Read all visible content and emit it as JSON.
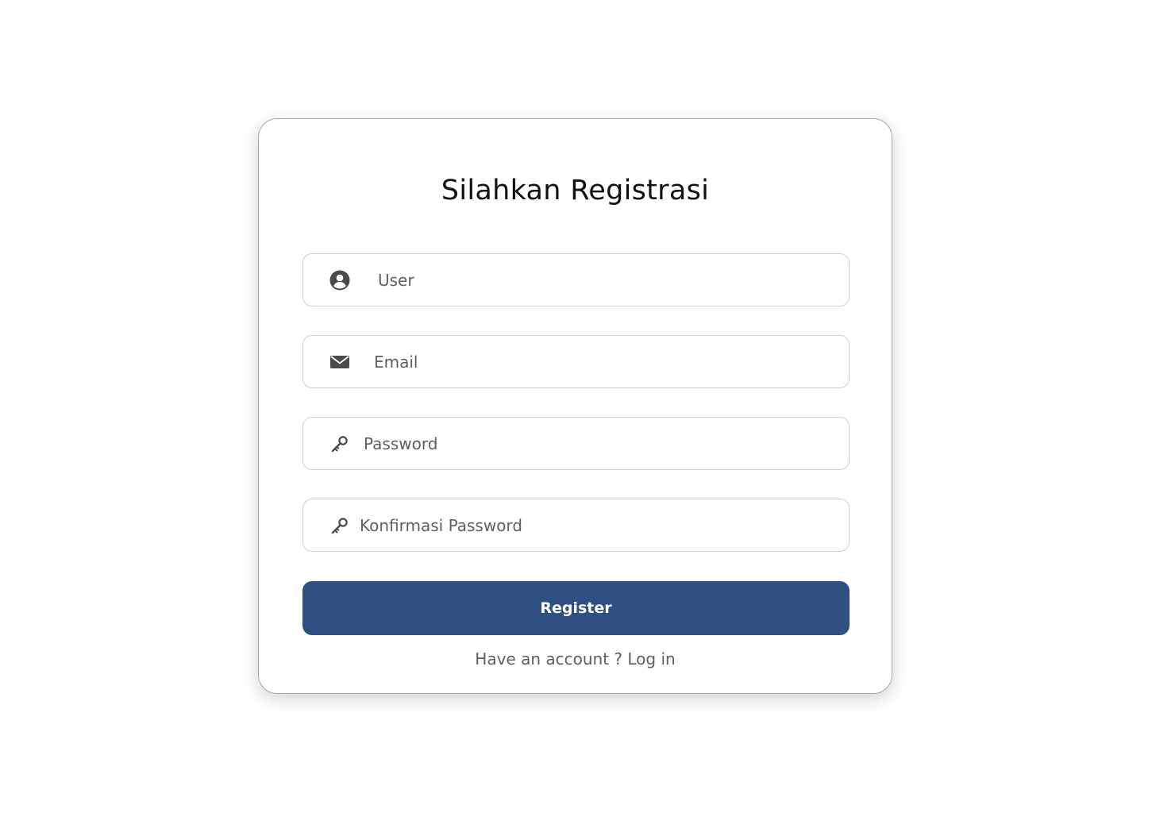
{
  "form": {
    "title": "Silahkan Registrasi",
    "fields": [
      {
        "icon": "user-circle-icon",
        "placeholder": "User",
        "value": ""
      },
      {
        "icon": "envelope-icon",
        "placeholder": "Email",
        "value": ""
      },
      {
        "icon": "key-icon",
        "placeholder": "Password",
        "value": ""
      },
      {
        "icon": "key-icon",
        "placeholder": "Konfirmasi Password",
        "value": ""
      }
    ],
    "submit_label": "Register",
    "login_prompt": "Have an account ?",
    "login_link": "Log in"
  },
  "colors": {
    "primary": "#2d4f82",
    "icon": "#4a4a4a",
    "placeholder": "#5f5f5f"
  }
}
